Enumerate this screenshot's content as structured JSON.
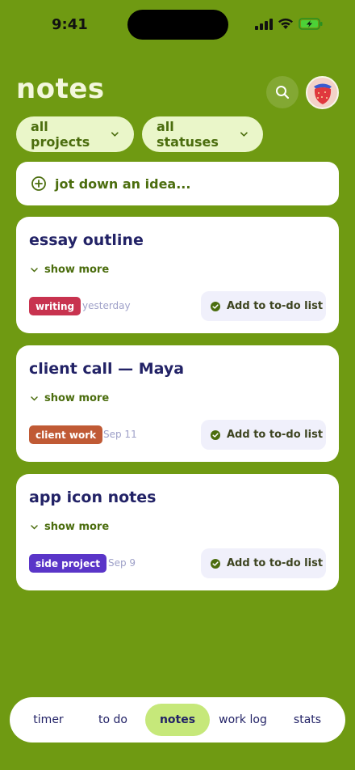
{
  "status_bar": {
    "time": "9:41"
  },
  "header": {
    "title": "notes"
  },
  "filters": {
    "projects": "all projects",
    "statuses": "all statuses"
  },
  "jot": {
    "placeholder": "jot down an idea..."
  },
  "notes": [
    {
      "title": "essay outline",
      "show_more": "show more",
      "tag": "writing",
      "tag_color": "#c8334f",
      "date": "yesterday",
      "action": "Add to to-do list"
    },
    {
      "title": "client call — Maya",
      "show_more": "show more",
      "tag": "client work",
      "tag_color": "#c05a35",
      "date": "Sep 11",
      "action": "Add to to-do list"
    },
    {
      "title": "app icon notes",
      "show_more": "show more",
      "tag": "side project",
      "tag_color": "#5a35c8",
      "date": "Sep 9",
      "action": "Add to to-do list"
    }
  ],
  "nav": {
    "items": [
      "timer",
      "to do",
      "notes",
      "work log",
      "stats"
    ],
    "active": "notes"
  },
  "colors": {
    "background": "#6f9a12",
    "accent": "#4b6d0e",
    "nav_active": "#c6e87a"
  }
}
